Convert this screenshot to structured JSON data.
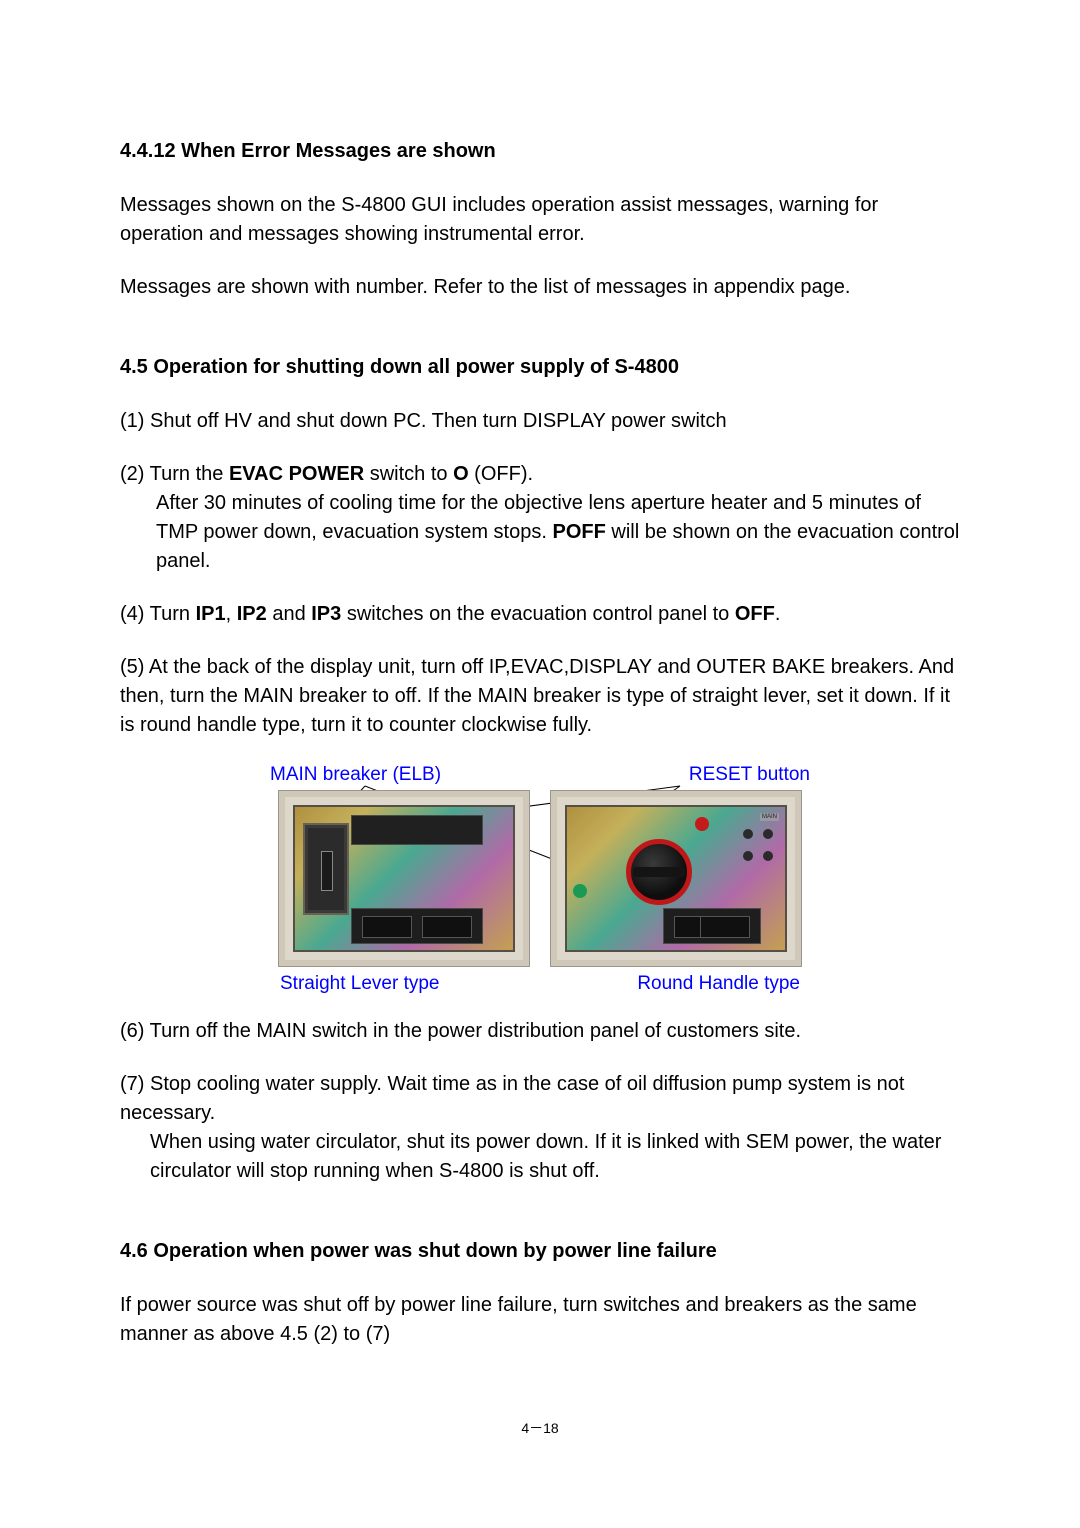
{
  "sec4412": {
    "heading": "4.4.12   When Error Messages are shown",
    "p1": "Messages shown on the S-4800 GUI includes operation assist messages, warning for operation and messages showing instrumental error.",
    "p2": "Messages are shown with number. Refer to the list of messages in appendix page."
  },
  "sec45": {
    "heading": "4.5   Operation for shutting down all power supply of S-4800",
    "step1": "(1)  Shut off HV and shut down PC. Then turn DISPLAY power switch",
    "step2_a": "(2)  Turn the ",
    "step2_evac": "EVAC POWER",
    "step2_b": " switch to ",
    "step2_o": "O",
    "step2_c": " (OFF).",
    "step2_line2a": "After 30 minutes of cooling time for the objective lens aperture heater and 5 minutes of TMP power down, evacuation system stops. ",
    "step2_poff": "POFF",
    "step2_line2b": " will be shown on the evacuation control panel.",
    "step4_a": "(4) Turn ",
    "step4_ip1": "IP1",
    "step4_comma1": ", ",
    "step4_ip2": "IP2",
    "step4_and": " and ",
    "step4_ip3": "IP3",
    "step4_b": " switches on the evacuation control panel to ",
    "step4_off": "OFF",
    "step4_c": ".",
    "step5": "(5) At the back of the display unit, turn off IP,EVAC,DISPLAY and OUTER BAKE breakers. And then, turn the MAIN breaker to off. If the MAIN breaker is type of straight lever, set it down. If it is round handle type, turn it to counter clockwise fully.",
    "fig_main": "MAIN breaker (ELB)",
    "fig_reset": "RESET button",
    "fig_straight": "Straight Lever type",
    "fig_round": "Round Handle type",
    "step6": "(6) Turn off the MAIN switch in the power distribution panel of customers site.",
    "step7a": "(7) Stop cooling water supply. Wait time as in the case of oil diffusion pump system is not necessary.",
    "step7b": "When using water circulator, shut its power down. If it is linked with SEM power, the water circulator will stop running when S-4800 is shut off."
  },
  "sec46": {
    "heading": "4.6   Operation when power was shut down by power line failure",
    "p": "If power source was shut off by power line failure, turn switches and breakers as the same manner as above 4.5 (2) to (7)"
  },
  "page_number": "4－18"
}
